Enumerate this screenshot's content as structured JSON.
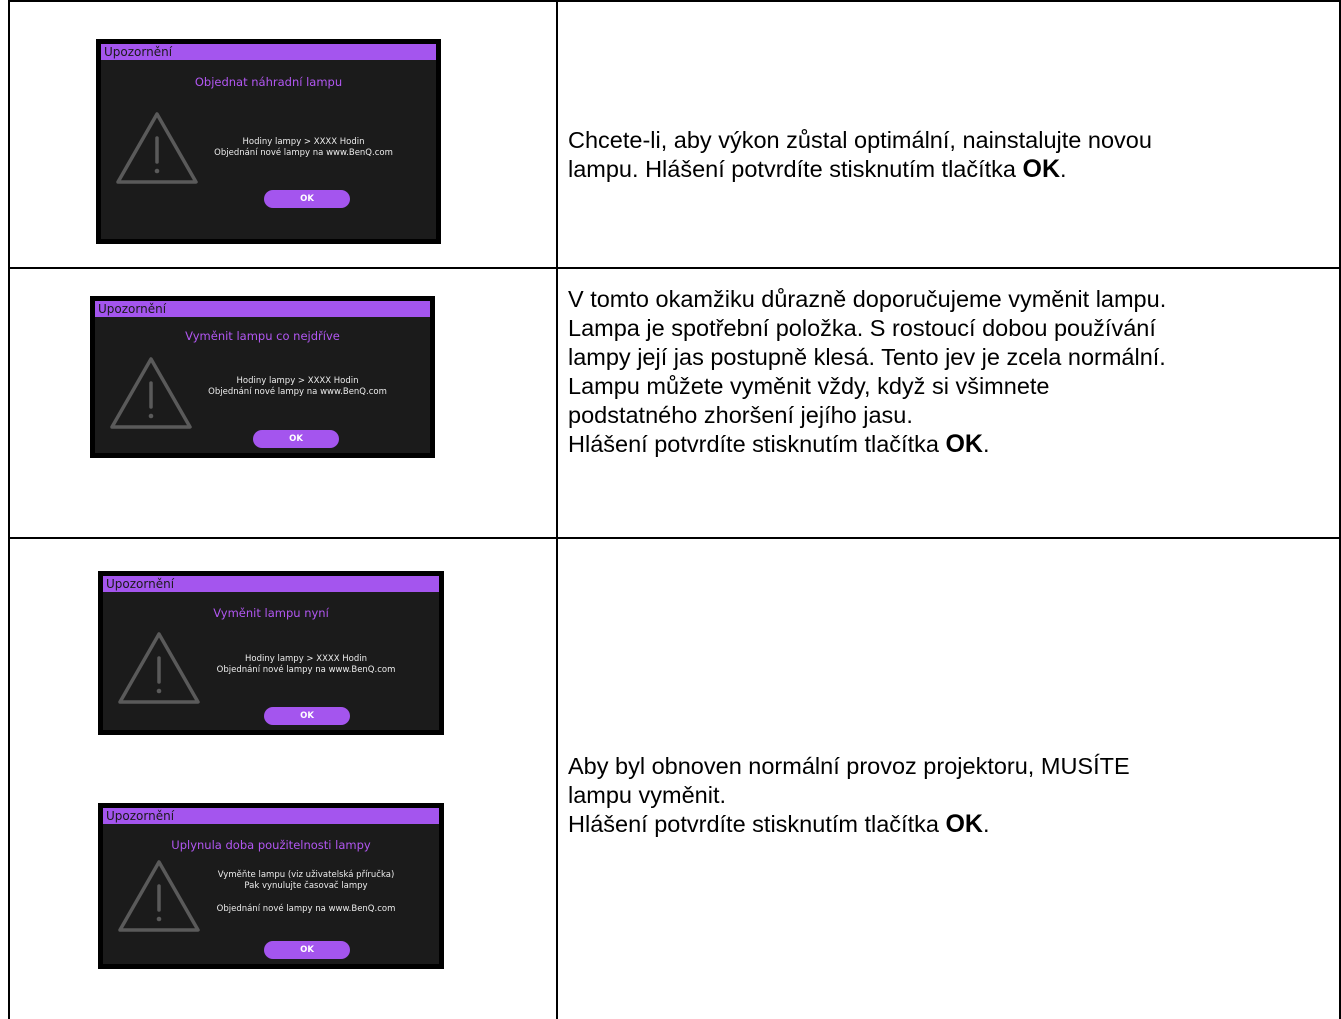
{
  "rows": [
    {
      "dialogs": [
        {
          "header": "Upozornění",
          "title": "Objednat náhradní lampu",
          "lines": [
            "Hodiny lampy > XXXX Hodin",
            "Objednání nové lampy na www.BenQ.com"
          ],
          "button": "OK"
        }
      ],
      "description": {
        "lines": [
          "Chcete-li, aby výkon zůstal optimální, nainstalujte novou",
          "lampu. Hlášení potvrdíte stisknutím tlačítka "
        ],
        "ok": "OK",
        "end": "."
      }
    },
    {
      "dialogs": [
        {
          "header": "Upozornění",
          "title": "Vyměnit lampu co nejdříve",
          "lines": [
            "Hodiny lampy > XXXX Hodin",
            "Objednání nové lampy na www.BenQ.com"
          ],
          "button": "OK"
        }
      ],
      "description": {
        "lines": [
          "V tomto okamžiku důrazně doporučujeme vyměnit lampu.",
          "Lampa je spotřební položka. S rostoucí dobou používání",
          "lampy její jas postupně klesá. Tento jev je zcela normální.",
          "Lampu můžete vyměnit vždy, když si všimnete",
          "podstatného zhoršení jejího jasu.",
          "Hlášení potvrdíte stisknutím tlačítka "
        ],
        "ok": "OK",
        "end": "."
      }
    },
    {
      "dialogs": [
        {
          "header": "Upozornění",
          "title": "Vyměnit lampu nyní",
          "lines": [
            "Hodiny lampy > XXXX Hodin",
            "Objednání nové lampy na www.BenQ.com"
          ],
          "button": "OK"
        },
        {
          "header": "Upozornění",
          "title": "Uplynula doba použitelnosti lampy",
          "lines": [
            "Vyměňte lampu (viz uživatelská příručka)",
            "Pak vynulujte časovač lampy",
            "Objednání nové lampy na www.BenQ.com"
          ],
          "button": "OK"
        }
      ],
      "description": {
        "lines": [
          "Aby byl obnoven normální provoz projektoru, MUSÍTE",
          "lampu vyměnit.",
          "Hlášení potvrdíte stisknutím tlačítka "
        ],
        "ok": "OK",
        "end": "."
      }
    }
  ]
}
